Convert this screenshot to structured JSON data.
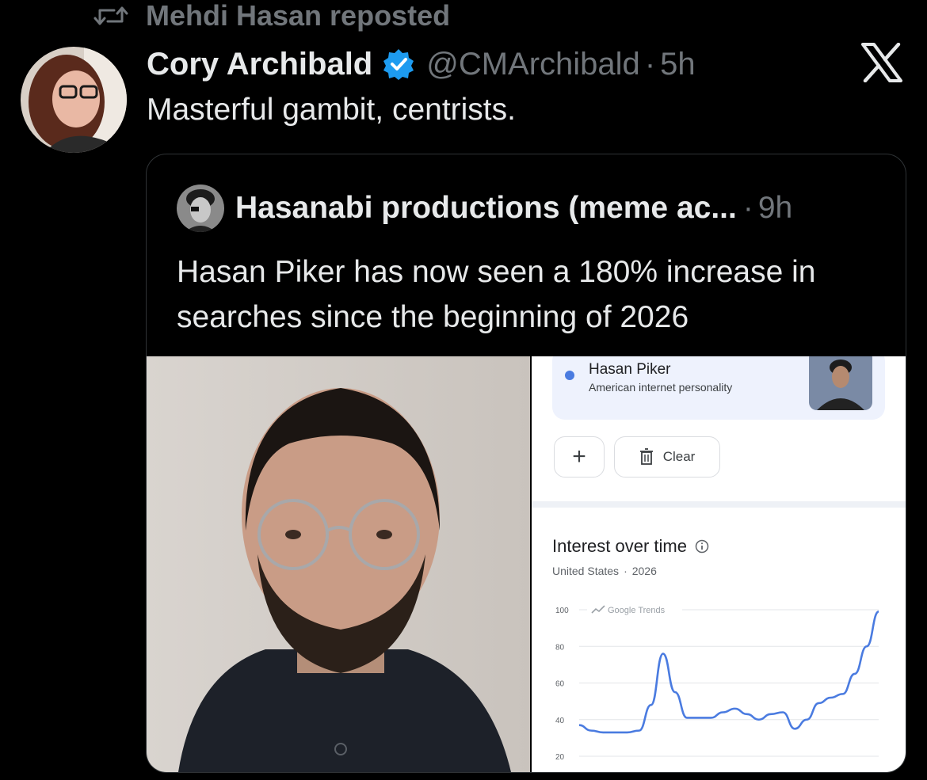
{
  "repost": {
    "label": "Mehdi Hasan reposted"
  },
  "post": {
    "author": "Cory Archibald",
    "handle": "@CMArchibald",
    "dot": "·",
    "time": "5h",
    "text": "Masterful gambit, centrists."
  },
  "quote": {
    "author": "Hasanabi productions (meme ac...",
    "dot": "·",
    "time": "9h",
    "text": "Hasan Piker has now seen a 180% increase in searches since the beginning of 2026"
  },
  "trends": {
    "term_name": "Hasan Piker",
    "term_desc": "American internet personality",
    "add_label": "+",
    "clear_label": "Clear",
    "section_title": "Interest over time",
    "region": "United States",
    "sep": "·",
    "year": "2026",
    "watermark": "Google Trends"
  },
  "colors": {
    "accent": "#1d9bf0",
    "series": "#4a7be0",
    "background": "#000000",
    "muted": "#71767b"
  },
  "icons": {
    "repost": "repost-icon",
    "verified": "verified-badge-icon",
    "platform": "x-logo-icon",
    "info": "info-icon",
    "trash": "trash-icon"
  },
  "chart_data": {
    "type": "line",
    "title": "",
    "xlabel": "",
    "ylabel": "",
    "ylim": [
      20,
      100
    ],
    "yticks": [
      100,
      80,
      60,
      40,
      20
    ],
    "grid": true,
    "series": [
      {
        "values": [
          37,
          34,
          33,
          33,
          33,
          34,
          48,
          76,
          55,
          41,
          41,
          41,
          44,
          46,
          43,
          40,
          43,
          44,
          35,
          40,
          49,
          52,
          54,
          65,
          80,
          99
        ]
      }
    ]
  }
}
